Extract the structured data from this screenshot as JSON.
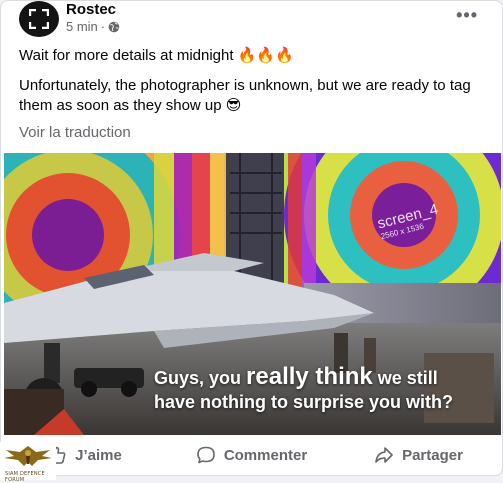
{
  "post": {
    "author": "Rostec",
    "time": "5 min",
    "separator": "·",
    "more_label": "•••",
    "paragraphs": [
      "Wait for more details at midnight 🔥🔥🔥",
      "Unfortunately, the photographer is unknown, but we are ready to tag them as soon as they show up 😎"
    ],
    "translate_label": "Voir la traduction"
  },
  "media": {
    "caption_pre": "Guys, you ",
    "caption_emphasis": "really think",
    "caption_post": " we still",
    "caption_line2": "have nothing to surprise you with?",
    "screen_label": "screen_4",
    "screen_res": "2560 x 1536"
  },
  "actions": {
    "like": "J’aime",
    "comment": "Commenter",
    "share": "Partager"
  },
  "badge": {
    "text": "SIAM DEFENCE FORUM"
  },
  "colors": {
    "text_primary": "#050505",
    "text_secondary": "#65676b",
    "card_border": "#dadde1",
    "page_background": "#f0f2f5"
  }
}
